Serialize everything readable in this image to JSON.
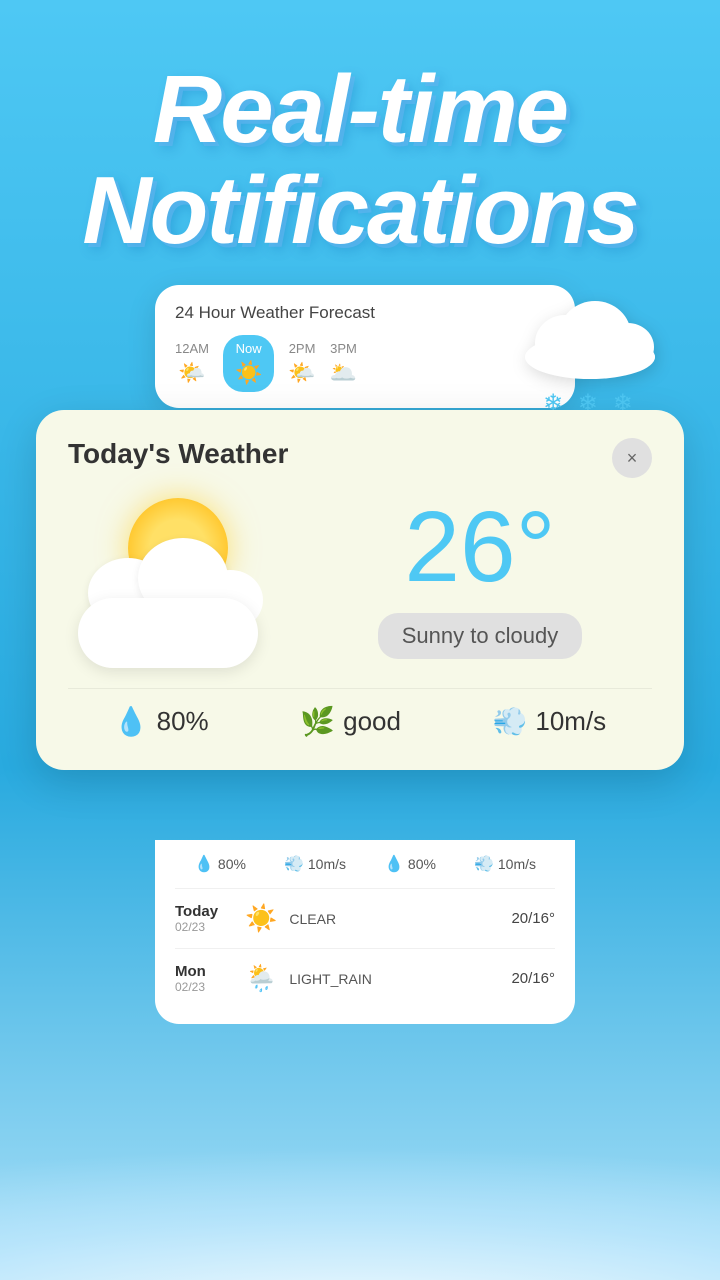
{
  "title": {
    "line1": "Real-time",
    "line2": "Notifications"
  },
  "forecast_card": {
    "title": "24 Hour Weather Forecast",
    "hours": [
      {
        "time": "12AM",
        "active": false
      },
      {
        "time": "Now",
        "active": true
      },
      {
        "time": "2PM",
        "active": false
      },
      {
        "time": "3PM",
        "active": false
      }
    ]
  },
  "weather_card": {
    "title": "Today's Weather",
    "close_label": "×",
    "temperature": "26°",
    "condition": "Sunny to cloudy",
    "stats": {
      "humidity": "80%",
      "air_quality": "good",
      "wind": "10m/s"
    }
  },
  "bottom_panel": {
    "stats_row": [
      {
        "icon": "💧",
        "value": "80%"
      },
      {
        "icon": "💨",
        "value": "10m/s"
      },
      {
        "icon": "💧",
        "value": "80%"
      },
      {
        "icon": "💨",
        "value": "10m/s"
      }
    ],
    "forecast": [
      {
        "day": "Today",
        "date": "02/23",
        "icon": "☀️",
        "condition": "CLEAR",
        "temp": "20/16°"
      },
      {
        "day": "Mon",
        "date": "02/23",
        "icon": "🌦️",
        "condition": "LIGHT_RAIN",
        "temp": "20/16°"
      }
    ]
  }
}
